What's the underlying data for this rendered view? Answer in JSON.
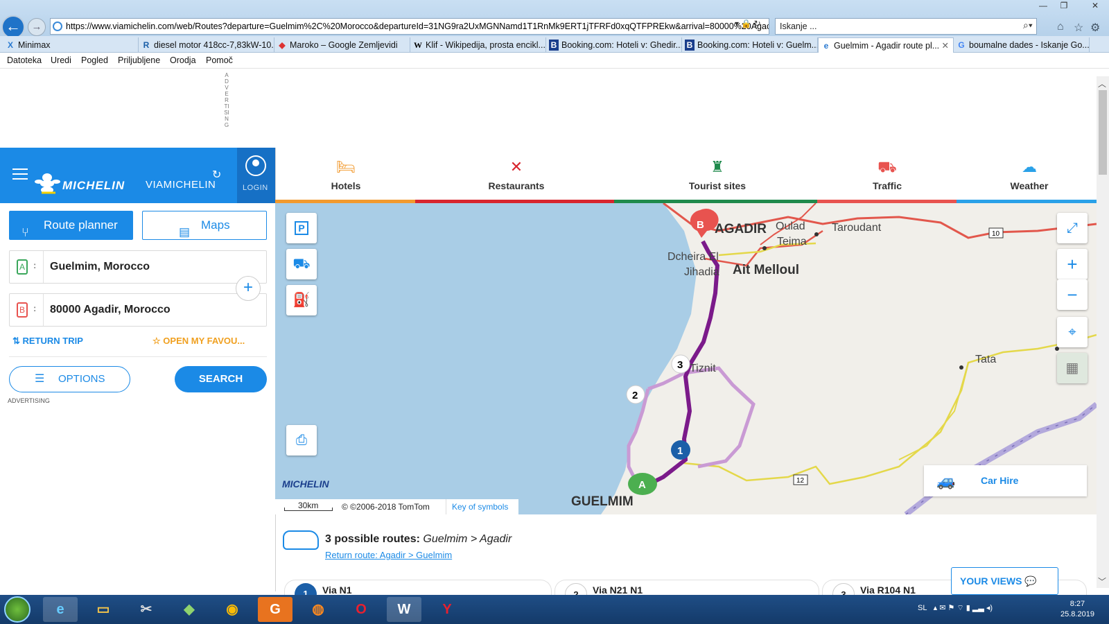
{
  "browser": {
    "url": "https://www.viamichelin.com/web/Routes?departure=Guelmim%2C%20Morocco&departureId=31NG9ra2UxMGNNamd1T1RnMk9ERT1jTFRFd0xqQTFPREkw&arrival=80000%20Agac",
    "search_placeholder": "Iskanje ...",
    "tabs": [
      {
        "label": "Minimax",
        "icon": "X"
      },
      {
        "label": "diesel motor 418cc-7,83kW-10...",
        "icon": "R"
      },
      {
        "label": "Maroko – Google Zemljevidi",
        "icon": "◆"
      },
      {
        "label": "Klif - Wikipedija, prosta encikl...",
        "icon": "W"
      },
      {
        "label": "Booking.com: Hoteli v: Ghedir...",
        "icon": "B"
      },
      {
        "label": "Booking.com: Hoteli v: Guelm...",
        "icon": "B"
      },
      {
        "label": "Guelmim - Agadir route pl...",
        "icon": "e"
      },
      {
        "label": "boumalne dades - Iskanje Go...",
        "icon": "G"
      }
    ],
    "menu": [
      "Datoteka",
      "Uredi",
      "Pogled",
      "Priljubljene",
      "Orodja",
      "Pomoč"
    ]
  },
  "ad_vertical": "ADVERTISING",
  "header": {
    "brand": "MICHELIN",
    "sub_brand": "VIAMICHELIN",
    "login_label": "LOGIN"
  },
  "planner": {
    "route_planner_label": "Route planner",
    "maps_label": "Maps",
    "departure": "Guelmim, Morocco",
    "arrival": "80000 Agadir, Morocco",
    "departure_marker": "A",
    "arrival_marker": "B",
    "return_trip_label": "RETURN TRIP",
    "favourites_label": "OPEN MY FAVOU...",
    "options_label": "OPTIONS",
    "search_label": "SEARCH",
    "advertising_label": "ADVERTISING"
  },
  "categories": [
    {
      "label": "Hotels",
      "icon": "bed-icon",
      "color": "#f29a2e"
    },
    {
      "label": "Restaurants",
      "icon": "fork-knife-icon",
      "color": "#d8262f"
    },
    {
      "label": "Tourist sites",
      "icon": "castle-icon",
      "color": "#1f8a4c"
    },
    {
      "label": "Traffic",
      "icon": "car-icon",
      "color": "#e8534f"
    },
    {
      "label": "Weather",
      "icon": "cloud-sun-icon",
      "color": "#2aa1e8"
    }
  ],
  "map": {
    "places": [
      "AGADIR",
      "Oulad",
      "Teima",
      "Taroudant",
      "Dcheira El",
      "Jihadia",
      "Ait Melloul",
      "Tata",
      "GUELMIM",
      "Tiznit"
    ],
    "road_shields": [
      "10",
      "12"
    ],
    "route_markers": [
      "1",
      "2",
      "3"
    ],
    "endpoint_a": "A",
    "endpoint_b": "B",
    "scale": "30km",
    "copyright": "© ©2006-2018 TomTom",
    "key_of_symbols": "Key of symbols",
    "car_hire": "Car Hire",
    "logo": "MICHELIN"
  },
  "results": {
    "count_text": "3 possible routes:",
    "route_text": "Guelmim > Agadir",
    "return_route": "Return route: Agadir > Guelmim",
    "cards": [
      {
        "num": "1",
        "name": "Via N1"
      },
      {
        "num": "2",
        "name": "Via N21 N1"
      },
      {
        "num": "3",
        "name": "Via R104 N1"
      }
    ],
    "your_views": "YOUR VIEWS"
  },
  "taskbar": {
    "lang": "SL",
    "time": "8:27",
    "date": "25.8.2019"
  },
  "colors": {
    "brand_blue": "#1b8ae6",
    "route_main": "#7b1a8a",
    "route_alt": "#c99ad4",
    "sea": "#a9cde6"
  }
}
